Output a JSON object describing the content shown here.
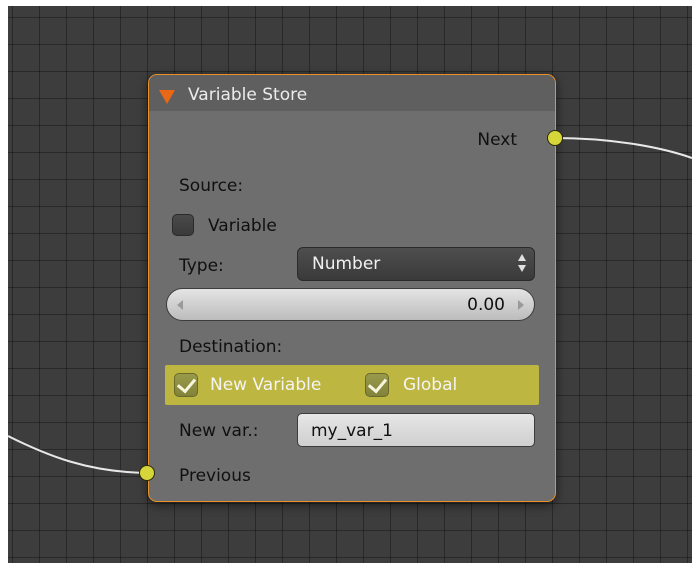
{
  "node": {
    "title": "Variable Store",
    "output_socket_label": "Next",
    "input_socket_label": "Previous",
    "source_label": "Source:",
    "variable_checkbox_label": "Variable",
    "variable_checked": false,
    "type_label": "Type:",
    "type_value": "Number",
    "number_value": "0.00",
    "destination_label": "Destination:",
    "new_variable_label": "New Variable",
    "new_variable_checked": true,
    "global_label": "Global",
    "global_checked": true,
    "new_var_label": "New var.:",
    "new_var_value": "my_var_1"
  },
  "colors": {
    "frame_border": "#e8902a",
    "collapse_arrow": "#e86818",
    "socket": "#d6d63a",
    "highlight": "#bdb641",
    "editor_background": "#3d3d3d"
  },
  "icons": {
    "collapse": "triangle-down-icon",
    "dropdown": "up-down-arrows-icon",
    "decrement": "arrow-left-icon",
    "increment": "arrow-right-icon",
    "check": "checkmark-icon"
  }
}
